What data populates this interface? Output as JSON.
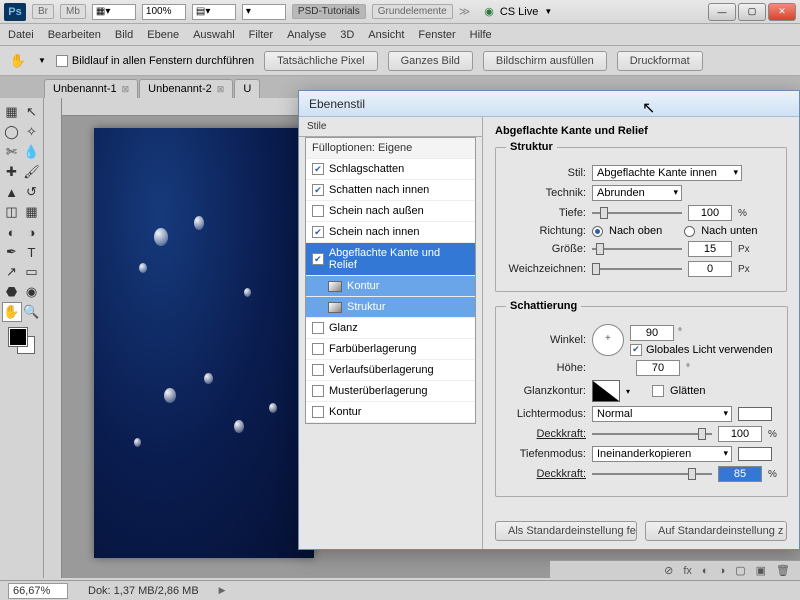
{
  "titlebar": {
    "logo": "Ps",
    "btns": [
      "Br",
      "Mb"
    ],
    "zoom": "100%",
    "tabs": [
      "PSD-Tutorials",
      "Grundelemente"
    ],
    "cslive": "CS Live"
  },
  "menu": [
    "Datei",
    "Bearbeiten",
    "Bild",
    "Ebene",
    "Auswahl",
    "Filter",
    "Analyse",
    "3D",
    "Ansicht",
    "Fenster",
    "Hilfe"
  ],
  "optbar": {
    "scroll_all": "Bildlauf in allen Fenstern durchführen",
    "buttons": [
      "Tatsächliche Pixel",
      "Ganzes Bild",
      "Bildschirm ausfüllen",
      "Druckformat"
    ]
  },
  "doctabs": [
    "Unbenannt-1",
    "Unbenannt-2",
    "U"
  ],
  "status": {
    "zoom": "66,67%",
    "dok": "Dok: 1,37 MB/2,86 MB"
  },
  "dialog": {
    "title": "Ebenenstil",
    "styles_hdr": "Stile",
    "fill_opts": "Fülloptionen: Eigene",
    "items": [
      {
        "label": "Schlagschatten",
        "checked": true
      },
      {
        "label": "Schatten nach innen",
        "checked": true
      },
      {
        "label": "Schein nach außen",
        "checked": false
      },
      {
        "label": "Schein nach innen",
        "checked": true
      },
      {
        "label": "Abgeflachte Kante und Relief",
        "checked": true,
        "selected": true
      },
      {
        "label": "Kontur",
        "checked": false,
        "sub": true,
        "selected": true
      },
      {
        "label": "Struktur",
        "checked": false,
        "sub": true,
        "selected": true
      },
      {
        "label": "Glanz",
        "checked": false
      },
      {
        "label": "Farbüberlagerung",
        "checked": false
      },
      {
        "label": "Verlaufsüberlagerung",
        "checked": false
      },
      {
        "label": "Musterüberlagerung",
        "checked": false
      },
      {
        "label": "Kontur",
        "checked": false
      }
    ],
    "section_title": "Abgeflachte Kante und Relief",
    "struktur": {
      "legend": "Struktur",
      "stil_label": "Stil:",
      "stil": "Abgeflachte Kante innen",
      "technik_label": "Technik:",
      "technik": "Abrunden",
      "tiefe_label": "Tiefe:",
      "tiefe": "100",
      "tiefe_unit": "%",
      "richtung_label": "Richtung:",
      "up": "Nach oben",
      "down": "Nach unten",
      "groesse_label": "Größe:",
      "groesse": "15",
      "px": "Px",
      "weich_label": "Weichzeichnen:",
      "weich": "0"
    },
    "schatt": {
      "legend": "Schattierung",
      "winkel_label": "Winkel:",
      "winkel": "90",
      "deg": "°",
      "global": "Globales Licht verwenden",
      "hoehe_label": "Höhe:",
      "hoehe": "70",
      "gk_label": "Glanzkontur:",
      "glaetten": "Glätten",
      "licht_label": "Lichtermodus:",
      "licht": "Normal",
      "deck_label": "Deckkraft:",
      "deck1": "100",
      "pct": "%",
      "tiefen_label": "Tiefenmodus:",
      "tiefen": "Ineinanderkopieren",
      "deck2": "85"
    },
    "btns": {
      "default": "Als Standardeinstellung festlegen",
      "reset": "Auf Standardeinstellung z"
    }
  }
}
